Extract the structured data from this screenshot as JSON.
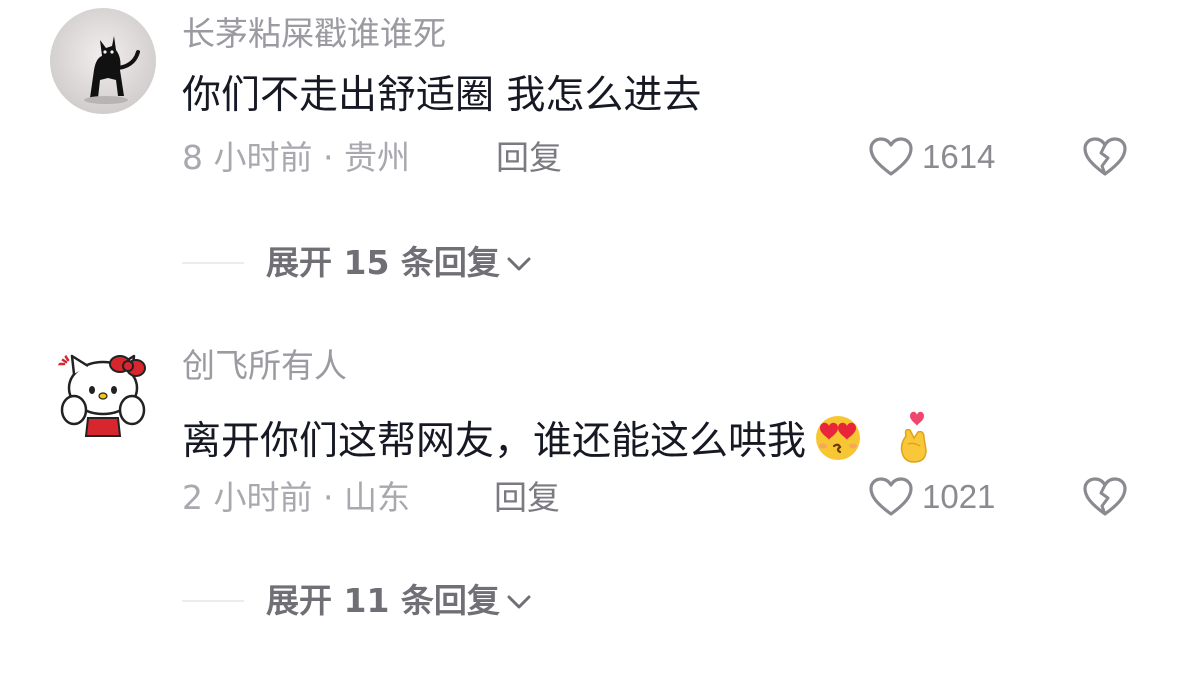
{
  "comments": [
    {
      "username": "长茅粘屎戳谁谁死",
      "content": "你们不走出舒适圈 我怎么进去",
      "time_location": "8 小时前 · 贵州",
      "reply_label": "回复",
      "likes": "1614",
      "expand_label": "展开 15 条回复",
      "avatar_icon": "black-cat-avatar",
      "emojis": []
    },
    {
      "username": "创飞所有人",
      "content": "离开你们这帮网友，谁还能这么哄我",
      "time_location": "2 小时前 · 山东",
      "reply_label": "回复",
      "likes": "1021",
      "expand_label": "展开 11 条回复",
      "avatar_icon": "hello-kitty-avatar",
      "emojis": [
        "heart-eyes-kiss-emoji",
        "finger-heart-emoji"
      ]
    }
  ],
  "colors": {
    "username": "#9a9aa0",
    "content": "#161823",
    "meta": "#a8a8ae",
    "icon": "#8a8a90",
    "divider": "#ececec"
  }
}
